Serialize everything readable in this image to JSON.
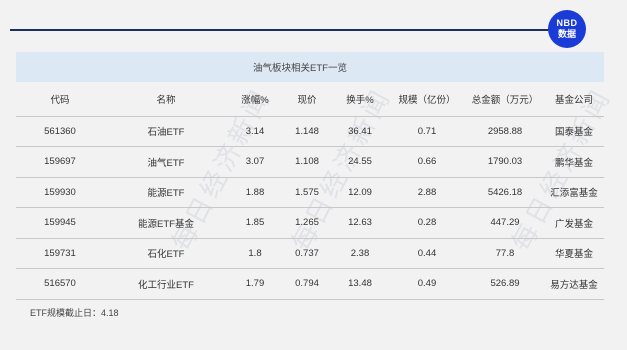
{
  "logo": {
    "line1": "NBD",
    "line2": "数据"
  },
  "title": "油气板块相关ETF一览",
  "columns": [
    "代码",
    "名称",
    "涨幅%",
    "现价",
    "换手%",
    "规模（亿份）",
    "总金额（万元）",
    "基金公司"
  ],
  "rows": [
    [
      "561360",
      "石油ETF",
      "3.14",
      "1.148",
      "36.41",
      "0.71",
      "2958.88",
      "国泰基金"
    ],
    [
      "159697",
      "油气ETF",
      "3.07",
      "1.108",
      "24.55",
      "0.66",
      "1790.03",
      "鹏华基金"
    ],
    [
      "159930",
      "能源ETF",
      "1.88",
      "1.575",
      "12.09",
      "2.88",
      "5426.18",
      "汇添富基金"
    ],
    [
      "159945",
      "能源ETF基金",
      "1.85",
      "1.265",
      "12.63",
      "0.28",
      "447.29",
      "广发基金"
    ],
    [
      "159731",
      "石化ETF",
      "1.8",
      "0.737",
      "2.38",
      "0.44",
      "77.8",
      "华夏基金"
    ],
    [
      "516570",
      "化工行业ETF",
      "1.79",
      "0.794",
      "13.48",
      "0.49",
      "526.89",
      "易方达基金"
    ]
  ],
  "footnote": "ETF规模截止日：4.18",
  "watermark": "每日经济新闻",
  "colors": {
    "top_line": "#1b2f63",
    "logo_bg": "#1a3bd6",
    "title_bar_bg": "#dce8f4",
    "page_bg": "#f2f2f2"
  }
}
